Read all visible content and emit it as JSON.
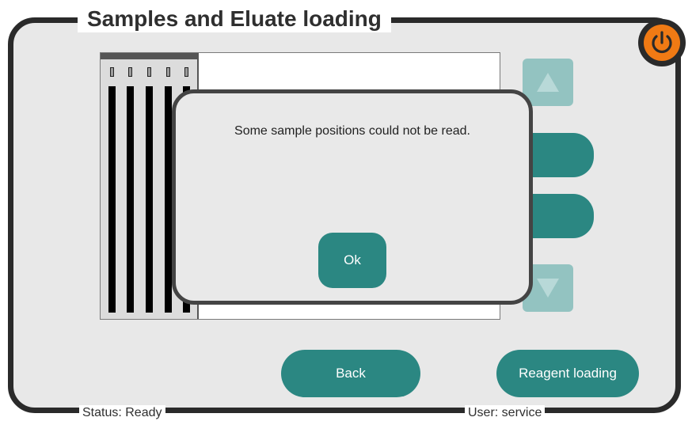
{
  "window": {
    "title": "Samples and Eluate loading"
  },
  "icons": {
    "power": "power-icon",
    "scroll_up": "triangle-up-icon",
    "scroll_down": "triangle-down-icon"
  },
  "colors": {
    "accent": "#2b8782",
    "power": "#f07a14",
    "frame": "#2a2a2a",
    "panel_bg": "#e8e8e8"
  },
  "rack": {
    "tube_count": 5
  },
  "dialog": {
    "message": "Some sample positions could not be read.",
    "ok_label": "Ok"
  },
  "footer": {
    "back_label": "Back",
    "reagent_loading_label": "Reagent loading",
    "status": "Status: Ready",
    "user": "User: service"
  }
}
